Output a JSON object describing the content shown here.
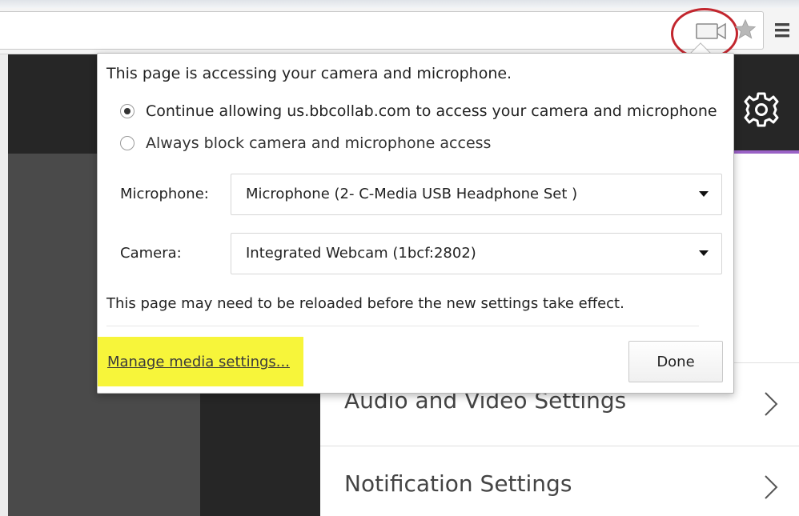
{
  "browser": {
    "camera_icon": "video-camera-icon",
    "star_icon": "bookmark-star-icon",
    "menu_icon": "hamburger-menu-icon",
    "highlight_circle_color": "#c2262e"
  },
  "app": {
    "header_color": "#262626",
    "accent_color": "#9a62c6",
    "gear_icon": "gear-icon",
    "settings": [
      {
        "label": "Audio and Video Settings"
      },
      {
        "label": "Notification Settings"
      }
    ]
  },
  "popup": {
    "title": "This page is accessing your camera and microphone.",
    "options": [
      {
        "label": "Continue allowing us.bbcollab.com to access your camera and microphone",
        "checked": true
      },
      {
        "label": "Always block camera and microphone access",
        "checked": false
      }
    ],
    "microphone": {
      "label": "Microphone:",
      "value": "Microphone (2- C-Media USB Headphone Set  )"
    },
    "camera": {
      "label": "Camera:",
      "value": "Integrated Webcam (1bcf:2802)"
    },
    "reload_note": "This page may need to be reloaded before the new settings take effect.",
    "manage_link": "Manage media settings...",
    "done_label": "Done",
    "highlight_color": "#f7f53a"
  }
}
